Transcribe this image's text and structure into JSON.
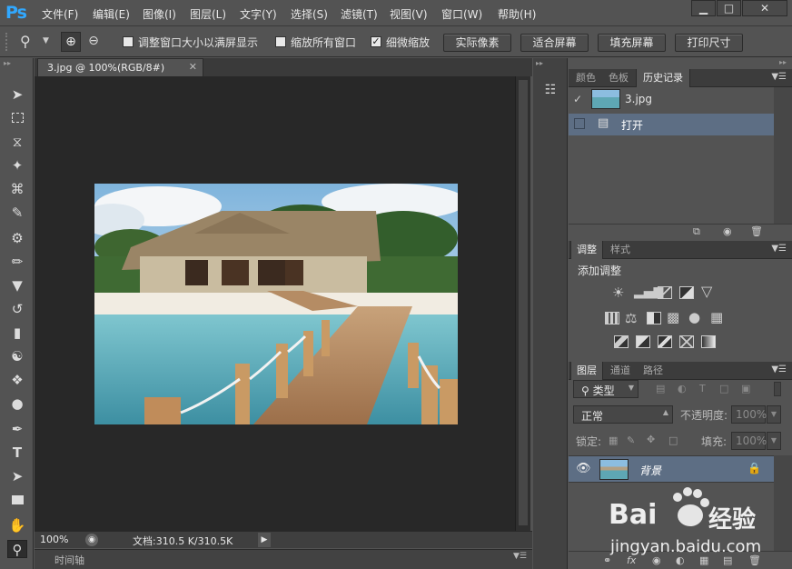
{
  "app": {
    "logo": "Ps"
  },
  "menu": [
    "文件(F)",
    "编辑(E)",
    "图像(I)",
    "图层(L)",
    "文字(Y)",
    "选择(S)",
    "滤镜(T)",
    "视图(V)",
    "窗口(W)",
    "帮助(H)"
  ],
  "window_controls": {
    "minimize": "▁",
    "maximize": "□",
    "close": "✕"
  },
  "options": {
    "resize_windows": {
      "label": "调整窗口大小以满屏显示",
      "checked": false
    },
    "zoom_all": {
      "label": "缩放所有窗口",
      "checked": false
    },
    "scrubby_zoom": {
      "label": "细微缩放",
      "checked": true
    },
    "buttons": [
      "实际像素",
      "适合屏幕",
      "填充屏幕",
      "打印尺寸"
    ]
  },
  "document": {
    "tab_title": "3.jpg @ 100%(RGB/8#)",
    "zoom": "100%",
    "doc_info": "文档:310.5 K/310.5K",
    "timeline_label": "时间轴"
  },
  "history_panel": {
    "tabs": [
      "颜色",
      "色板",
      "历史记录"
    ],
    "active_tab": "历史记录",
    "snapshot_name": "3.jpg",
    "states": [
      "打开"
    ]
  },
  "adjustments_panel": {
    "tabs": [
      "调整",
      "样式"
    ],
    "active_tab": "调整",
    "title": "添加调整"
  },
  "layers_panel": {
    "tabs": [
      "图层",
      "通道",
      "路径"
    ],
    "active_tab": "图层",
    "filter_kind": "类型",
    "blend_mode": "正常",
    "opacity_label": "不透明度:",
    "opacity_value": "100%",
    "lock_label": "锁定:",
    "fill_label": "填充:",
    "fill_value": "100%",
    "layers": [
      {
        "name": "背景",
        "visible": true,
        "locked": true
      }
    ]
  },
  "watermark": {
    "brand": "Bai",
    "brand2": "经验",
    "url": "jingyan.baidu.com"
  }
}
